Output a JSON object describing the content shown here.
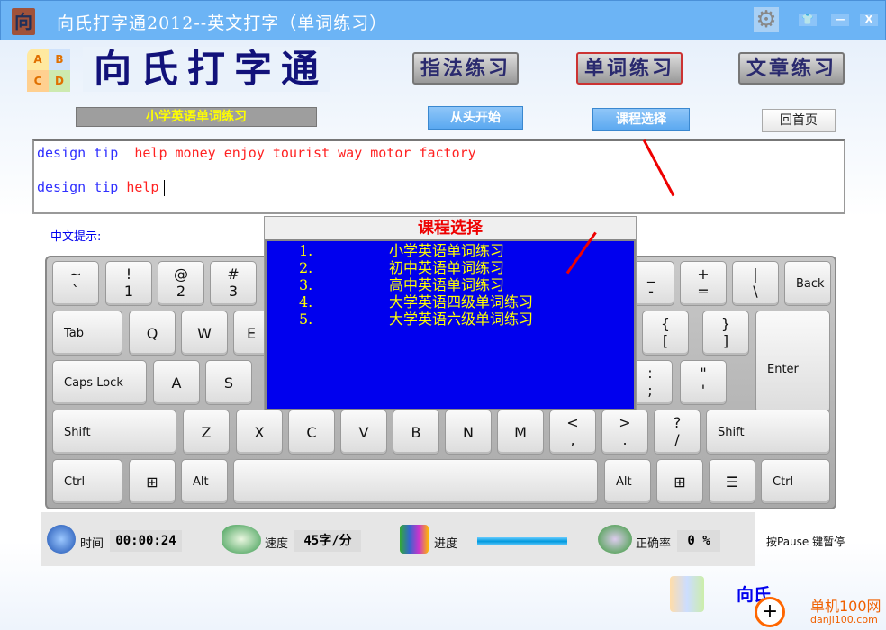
{
  "window": {
    "title": "向氏打字通2012--英文打字（单词练习）",
    "icon_char": "向",
    "controls": [
      "skin-icon",
      "minimize-icon",
      "close-icon"
    ],
    "skin": "👕",
    "minimize": "—",
    "close": "X"
  },
  "brand": {
    "name": "向氏打字通",
    "logo_letters": [
      "A",
      "B",
      "C",
      "D"
    ]
  },
  "modes": [
    {
      "label": "指法练习"
    },
    {
      "label": "单词练习",
      "active": true
    },
    {
      "label": "文章练习"
    }
  ],
  "toolbar": {
    "current_course": "小学英语单词练习",
    "restart": "从头开始",
    "course_select": "课程选择",
    "home": "回首页"
  },
  "typing": {
    "target_typed": "design tip ",
    "target_remaining": "help money enjoy tourist way motor factory",
    "input_correct": "design tip ",
    "input_current": "help"
  },
  "hint_label": "中文提示:",
  "keyboard": {
    "rows": [
      [
        [
          "~",
          "`"
        ],
        [
          "!",
          "1"
        ],
        [
          "@",
          "2"
        ],
        [
          "#",
          "3"
        ],
        [
          "_",
          "-"
        ],
        [
          "+",
          "="
        ],
        [
          "|",
          "\\"
        ],
        [
          "Back space"
        ]
      ],
      [
        [
          "Tab"
        ],
        [
          "Q"
        ],
        [
          "W"
        ],
        [
          "E"
        ],
        [
          "{",
          "["
        ],
        [
          "}",
          "]"
        ],
        [
          "Enter"
        ]
      ],
      [
        [
          "Caps Lock"
        ],
        [
          "A"
        ],
        [
          "S"
        ],
        [
          ":",
          ";"
        ],
        [
          "\"",
          "'"
        ]
      ],
      [
        [
          "Shift"
        ],
        [
          "Z"
        ],
        [
          "X"
        ],
        [
          "C"
        ],
        [
          "V"
        ],
        [
          "B"
        ],
        [
          "N"
        ],
        [
          "M"
        ],
        [
          "<",
          ","
        ],
        [
          ">",
          "."
        ],
        [
          "?",
          "/"
        ],
        [
          "Shift"
        ]
      ],
      [
        [
          "Ctrl"
        ],
        [
          "⊞"
        ],
        [
          "Alt"
        ],
        [
          ""
        ],
        [
          "Alt"
        ],
        [
          "⊞"
        ],
        [
          "☰"
        ],
        [
          "Ctrl"
        ]
      ]
    ]
  },
  "dialog": {
    "title": "课程选择",
    "options": [
      {
        "num": "1.",
        "label": "小学英语单词练习"
      },
      {
        "num": "2.",
        "label": "初中英语单词练习"
      },
      {
        "num": "3.",
        "label": "高中英语单词练习"
      },
      {
        "num": "4.",
        "label": "大学英语四级单词练习"
      },
      {
        "num": "5.",
        "label": "大学英语六级单词练习"
      }
    ]
  },
  "status": {
    "time_label": "时间",
    "time": "00:00:24",
    "speed_label": "速度",
    "speed": "45字/分",
    "progress_label": "进度",
    "progress_percent": 100,
    "accuracy_label": "正确率",
    "accuracy": "0 %",
    "pause_hint": "按Pause 键暂停"
  },
  "footer": {
    "brand_fragment": "向氏"
  },
  "watermark": {
    "text": "单机100网",
    "url_text": "danji100.com"
  },
  "colors": {
    "titlebar": "#6cb4f5",
    "typed": "#3030ff",
    "pending": "#ff2222",
    "dialog_bg": "#0000ee",
    "dialog_text": "#ffff00"
  }
}
